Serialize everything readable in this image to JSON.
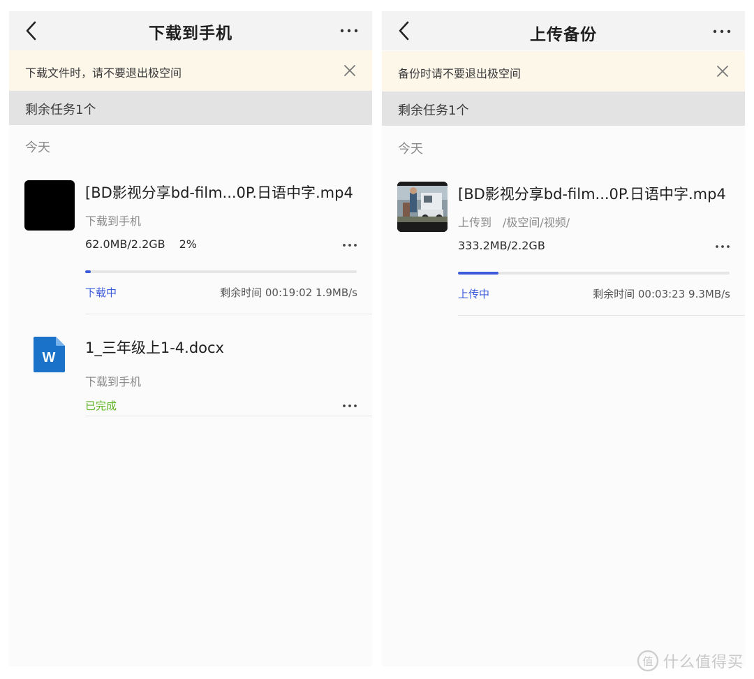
{
  "left_screen": {
    "title": "下载到手机",
    "notice": "下载文件时，请不要退出极空间",
    "section": "剩余任务1个",
    "date_label": "今天",
    "items": [
      {
        "name": "[BD影视分享bd-film...0P.日语中字.mp4",
        "subtitle": "下载到手机",
        "size": "62.0MB/2.2GB",
        "percent": "2%",
        "progress": 0.02,
        "status": "下载中",
        "eta": "剩余时间 00:19:02 1.9MB/s",
        "thumbnail": "black-thumbnail"
      },
      {
        "name": "1_三年级上1-4.docx",
        "subtitle": "下载到手机",
        "status": "已完成",
        "icon": "word-document-icon"
      }
    ]
  },
  "right_screen": {
    "title": "上传备份",
    "notice": "备份时请不要退出极空间",
    "section": "剩余任务1个",
    "date_label": "今天",
    "items": [
      {
        "name": "[BD影视分享bd-film...0P.日语中字.mp4",
        "subtitle": "上传到　/极空间/视频/",
        "size": "333.2MB/2.2GB",
        "progress": 0.15,
        "status": "上传中",
        "eta": "剩余时间 00:03:23 9.3MB/s",
        "thumbnail": "video-thumbnail"
      }
    ]
  },
  "watermark": {
    "logo_char": "值",
    "text": "什么值得买"
  },
  "colors": {
    "accent_blue": "#3b5bdb",
    "done_green": "#5bb21c",
    "notice_bg": "#fdf7ea",
    "section_bg": "#e3e3e3",
    "word_blue": "#1a73c8"
  }
}
